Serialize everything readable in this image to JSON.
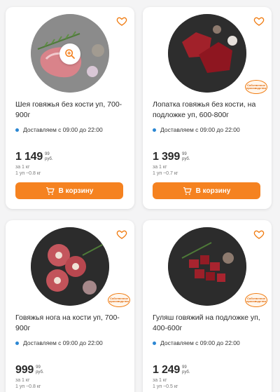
{
  "colors": {
    "accent": "#f58220",
    "heart": "#f07b10",
    "delivery_dot": "#2b87d3"
  },
  "products": [
    {
      "name": "Шея говяжья без кости уп, 700-900г",
      "delivery": "Доставляем с 09:00 до 22:00",
      "price_main": "1 149",
      "price_kop": "99",
      "price_currency": "руб.",
      "unit_1": "за 1 кг",
      "unit_2": "1 уп ~0.8 кг",
      "cart_label": "В корзину",
      "has_badge": false,
      "badge_text": ""
    },
    {
      "name": "Лопатка говяжья без кости, на подложке уп, 600-800г",
      "delivery": "Доставляем с 09:00 до 22:00",
      "price_main": "1 399",
      "price_kop": "99",
      "price_currency": "руб.",
      "unit_1": "за 1 кг",
      "unit_2": "1 уп ~0.7 кг",
      "cart_label": "В корзину",
      "has_badge": true,
      "badge_text": "Собственное производство"
    },
    {
      "name": "Говяжья нога на кости уп, 700-900г",
      "delivery": "Доставляем с 09:00 до 22:00",
      "price_main": "999",
      "price_kop": "99",
      "price_currency": "руб.",
      "unit_1": "за 1 кг",
      "unit_2": "1 уп ~0.8 кг",
      "has_badge": true,
      "badge_text": "Собственное производство"
    },
    {
      "name": "Гуляш говяжий на подложке уп, 400-600г",
      "delivery": "Доставляем с 09:00 до 22:00",
      "price_main": "1 249",
      "price_kop": "99",
      "price_currency": "руб.",
      "unit_1": "за 1 кг",
      "unit_2": "1 уп ~0.5 кг",
      "has_badge": true,
      "badge_text": "Собственное производство"
    }
  ]
}
